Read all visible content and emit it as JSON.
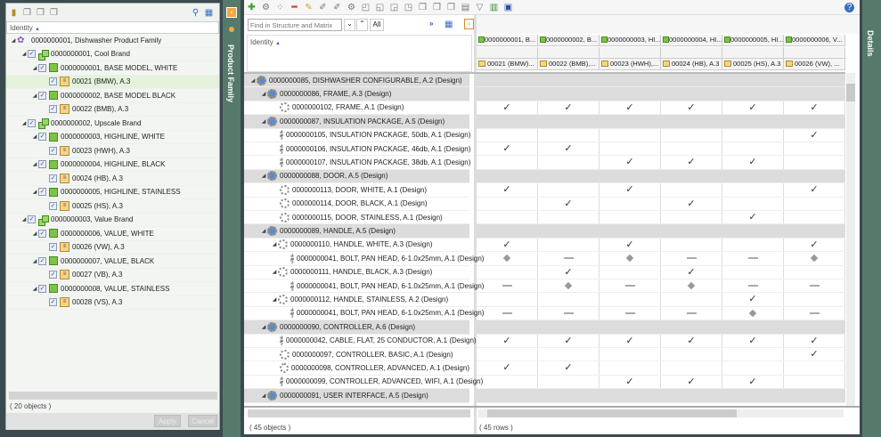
{
  "left_panel": {
    "header": "Identity",
    "status": "( 20 objects )",
    "apply": "Apply",
    "cancel": "Cancel",
    "tree": [
      {
        "level": 0,
        "type": "family",
        "label": "0000000001, Dishwasher Product Family"
      },
      {
        "level": 1,
        "type": "brand",
        "label": "0000000001, Cool Brand"
      },
      {
        "level": 2,
        "type": "model",
        "label": "0000000001, BASE MODEL, WHITE"
      },
      {
        "level": 3,
        "type": "config",
        "label": "00021 (BMW), A.3",
        "selected": true
      },
      {
        "level": 2,
        "type": "model",
        "label": "0000000002, BASE MODEL BLACK"
      },
      {
        "level": 3,
        "type": "config",
        "label": "00022 (BMB), A.3"
      },
      {
        "level": 1,
        "type": "brand",
        "label": "0000000002, Upscale Brand"
      },
      {
        "level": 2,
        "type": "model",
        "label": "0000000003, HIGHLINE, WHITE"
      },
      {
        "level": 3,
        "type": "config",
        "label": "00023 (HWH), A.3"
      },
      {
        "level": 2,
        "type": "model",
        "label": "0000000004, HIGHLINE, BLACK"
      },
      {
        "level": 3,
        "type": "config",
        "label": "00024 (HB), A.3"
      },
      {
        "level": 2,
        "type": "model",
        "label": "0000000005, HIGHLINE, STAINLESS"
      },
      {
        "level": 3,
        "type": "config",
        "label": "00025 (HS), A.3"
      },
      {
        "level": 1,
        "type": "brand",
        "label": "0000000003, Value Brand"
      },
      {
        "level": 2,
        "type": "model",
        "label": "0000000006, VALUE, WHITE"
      },
      {
        "level": 3,
        "type": "config",
        "label": "00026 (VW), A.3"
      },
      {
        "level": 2,
        "type": "model",
        "label": "0000000007, VALUE, BLACK"
      },
      {
        "level": 3,
        "type": "config",
        "label": "00027 (VB), A.3"
      },
      {
        "level": 2,
        "type": "model",
        "label": "0000000008, VALUE, STAINLESS"
      },
      {
        "level": 3,
        "type": "config",
        "label": "00028 (VS), A.3"
      }
    ]
  },
  "side_tabs": {
    "left": "Product Family",
    "right": "Details"
  },
  "search": {
    "placeholder": "Find in Structure and Matrix",
    "all": "All"
  },
  "structure": {
    "header": "Identity",
    "status": "( 45 objects )"
  },
  "matrix": {
    "status": "( 45 rows )",
    "columns_models": [
      "0000000001, B...",
      "0000000002, B...",
      "0000000003, HI...",
      "0000000004, HI...",
      "0000000005, HI...",
      "0000000006, V..."
    ],
    "columns_configs": [
      "00021 (BMW)...",
      "00022 (BMB),...",
      "00023 (HWH),...",
      "00024 (HB), A.3",
      "00025 (HS), A.3",
      "00026 (VW), ..."
    ]
  },
  "rows": [
    {
      "level": 0,
      "group": true,
      "label": "0000000085, DISHWASHER CONFIGURABLE, A.2 (Design)",
      "marks": [
        "",
        "",
        "",
        "",
        "",
        ""
      ]
    },
    {
      "level": 1,
      "group": true,
      "label": "0000000086, FRAME, A.3 (Design)",
      "marks": [
        "",
        "",
        "",
        "",
        "",
        ""
      ]
    },
    {
      "level": 2,
      "label": "0000000102, FRAME, A.1 (Design)",
      "marks": [
        "check",
        "check",
        "check",
        "check",
        "check",
        "check"
      ]
    },
    {
      "level": 1,
      "group": true,
      "label": "0000000087, INSULATION PACKAGE, A.5 (Design)",
      "marks": [
        "",
        "",
        "",
        "",
        "",
        ""
      ]
    },
    {
      "level": 2,
      "label": "0000000105, INSULATION PACKAGE, 50db, A.1 (Design)",
      "marks": [
        "",
        "",
        "",
        "",
        "",
        "check"
      ]
    },
    {
      "level": 2,
      "label": "0000000106, INSULATION PACKAGE, 46db, A.1 (Design)",
      "marks": [
        "check",
        "check",
        "",
        "",
        "",
        ""
      ]
    },
    {
      "level": 2,
      "label": "0000000107, INSULATION PACKAGE, 38db, A.1 (Design)",
      "marks": [
        "",
        "",
        "check",
        "check",
        "check",
        ""
      ]
    },
    {
      "level": 1,
      "group": true,
      "label": "0000000088, DOOR, A.5 (Design)",
      "marks": [
        "",
        "",
        "",
        "",
        "",
        ""
      ]
    },
    {
      "level": 2,
      "label": "0000000113, DOOR, WHITE, A.1 (Design)",
      "marks": [
        "check",
        "",
        "check",
        "",
        "",
        "check"
      ]
    },
    {
      "level": 2,
      "label": "0000000114, DOOR, BLACK, A.1 (Design)",
      "marks": [
        "",
        "check",
        "",
        "check",
        "",
        ""
      ]
    },
    {
      "level": 2,
      "label": "0000000115, DOOR, STAINLESS, A.1 (Design)",
      "marks": [
        "",
        "",
        "",
        "",
        "check",
        ""
      ]
    },
    {
      "level": 1,
      "group": true,
      "label": "0000000089, HANDLE, A.5 (Design)",
      "marks": [
        "",
        "",
        "",
        "",
        "",
        ""
      ]
    },
    {
      "level": 2,
      "sub": true,
      "label": "0000000110, HANDLE, WHITE, A.3 (Design)",
      "marks": [
        "check",
        "",
        "check",
        "",
        "",
        "check"
      ]
    },
    {
      "level": 3,
      "label": "0000000041, BOLT, PAN HEAD, 6-1.0x25mm, A.1 (Design)",
      "marks": [
        "diamond",
        "dash",
        "diamond",
        "dash",
        "dash",
        "diamond"
      ]
    },
    {
      "level": 2,
      "sub": true,
      "label": "0000000111, HANDLE, BLACK, A.3 (Design)",
      "marks": [
        "",
        "check",
        "",
        "check",
        "",
        ""
      ]
    },
    {
      "level": 3,
      "label": "0000000041, BOLT, PAN HEAD, 6-1.0x25mm, A.1 (Design)",
      "marks": [
        "dash",
        "diamond",
        "dash",
        "diamond",
        "dash",
        "dash"
      ]
    },
    {
      "level": 2,
      "sub": true,
      "label": "0000000112, HANDLE, STAINLESS, A.2 (Design)",
      "marks": [
        "",
        "",
        "",
        "",
        "check",
        ""
      ]
    },
    {
      "level": 3,
      "label": "0000000041, BOLT, PAN HEAD, 6-1.0x25mm, A.1 (Design)",
      "marks": [
        "dash",
        "dash",
        "dash",
        "dash",
        "diamond",
        "dash"
      ]
    },
    {
      "level": 1,
      "group": true,
      "label": "0000000090, CONTROLLER, A.6 (Design)",
      "marks": [
        "",
        "",
        "",
        "",
        "",
        ""
      ]
    },
    {
      "level": 2,
      "label": "0000000042, CABLE, FLAT, 25 CONDUCTOR, A.1 (Design)",
      "marks": [
        "check",
        "check",
        "check",
        "check",
        "check",
        "check"
      ]
    },
    {
      "level": 2,
      "label": "0000000097, CONTROLLER, BASIC, A.1 (Design)",
      "marks": [
        "",
        "",
        "",
        "",
        "",
        "check"
      ]
    },
    {
      "level": 2,
      "label": "0000000098, CONTROLLER, ADVANCED, A.1 (Design)",
      "marks": [
        "check",
        "check",
        "",
        "",
        "",
        ""
      ]
    },
    {
      "level": 2,
      "label": "0000000099, CONTROLLER, ADVANCED, WIFI, A.1 (Design)",
      "marks": [
        "",
        "",
        "check",
        "check",
        "check",
        ""
      ]
    },
    {
      "level": 1,
      "group": true,
      "label": "0000000091, USER INTERFACE, A.5 (Design)",
      "marks": [
        "",
        "",
        "",
        "",
        "",
        ""
      ]
    }
  ]
}
